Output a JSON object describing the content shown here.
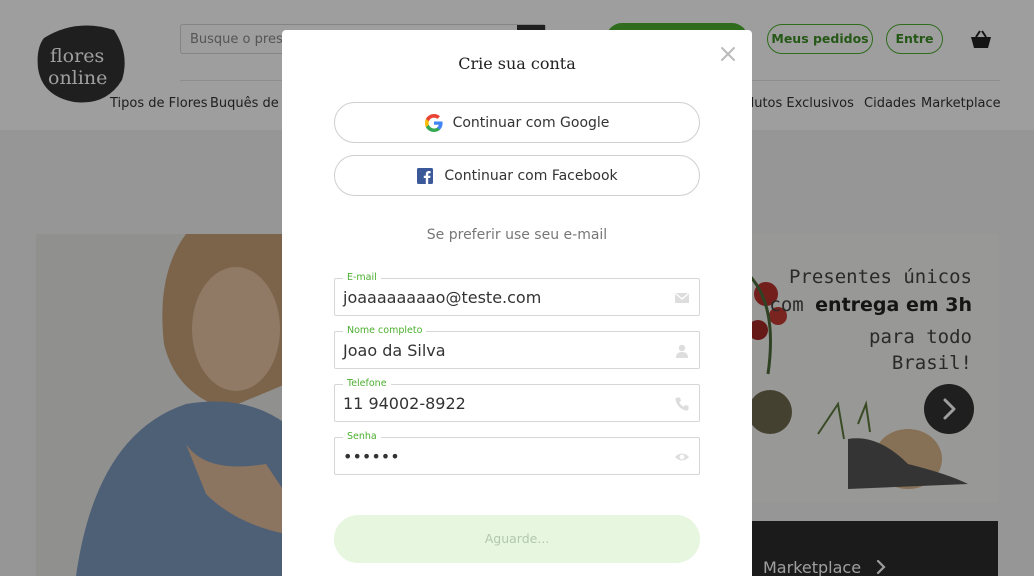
{
  "header": {
    "logo_text": "flores online",
    "search_placeholder": "Busque o prese",
    "orders_button": "Meus pedidos",
    "login_button": "Entre",
    "nav": [
      "Tipos de Flores",
      "Buquês de F",
      "odutos Exclusivos",
      "Cidades",
      "Marketplace"
    ]
  },
  "hero": {
    "line1": "Presentes únicos",
    "line2_prefix": "com ",
    "line2_bold": "entrega em 3h",
    "line3": "para todo",
    "line4": "Brasil!"
  },
  "marketplace_banner": {
    "label": "Marketplace"
  },
  "modal": {
    "title": "Crie sua conta",
    "google_button": "Continuar com Google",
    "facebook_button": "Continuar com Facebook",
    "divider_text": "Se preferir use seu e-mail",
    "fields": {
      "email": {
        "label": "E-mail",
        "value": "joaaaaaaaao@teste.com"
      },
      "name": {
        "label": "Nome completo",
        "value": "Joao da Silva"
      },
      "phone": {
        "label": "Telefone",
        "value": "11 94002-8922"
      },
      "password": {
        "label": "Senha",
        "value": "••••••"
      }
    },
    "submit_button": "Aguarde..."
  },
  "colors": {
    "brand_green": "#4caf2f",
    "submit_disabled_bg": "#e6f6df",
    "overlay": "rgba(0,0,0,0.38)"
  }
}
